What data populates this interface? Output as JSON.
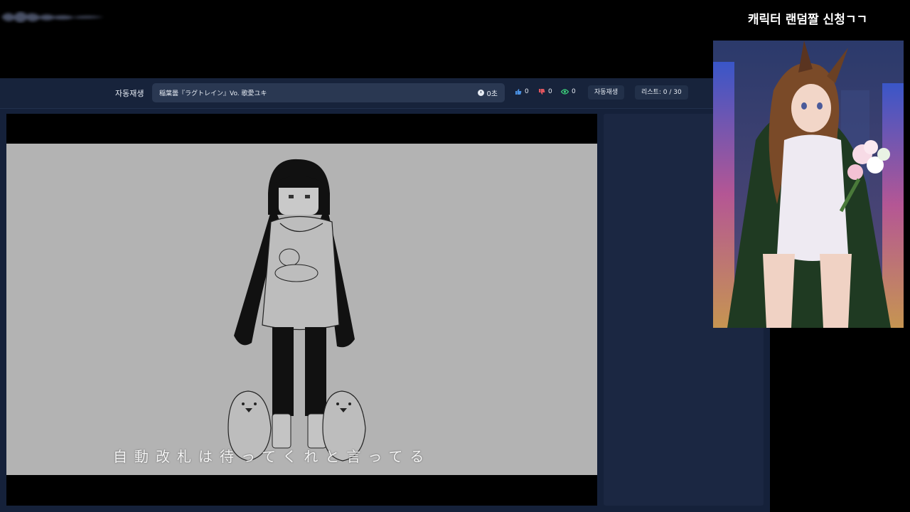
{
  "overlay": {
    "title": "캐릭터 랜덤짤 신청ㄱㄱ"
  },
  "toolbar": {
    "autoplay_label": "자동재생",
    "current_song": "稲葉曇『ラグトレイン』Vo. 歌愛ユキ",
    "timer": "0초",
    "likes": "0",
    "dislikes": "0",
    "views": "0",
    "autoplay_button": "자동재생",
    "list_count": "리스트: 0 / 30"
  },
  "player": {
    "subtitle": "自動改札は待ってくれと言ってる"
  },
  "colors": {
    "app_bg": "#15213a",
    "input_bg": "#2a3852",
    "like": "#4a90e2",
    "dislike": "#e0555e",
    "view": "#3ccf7a"
  }
}
